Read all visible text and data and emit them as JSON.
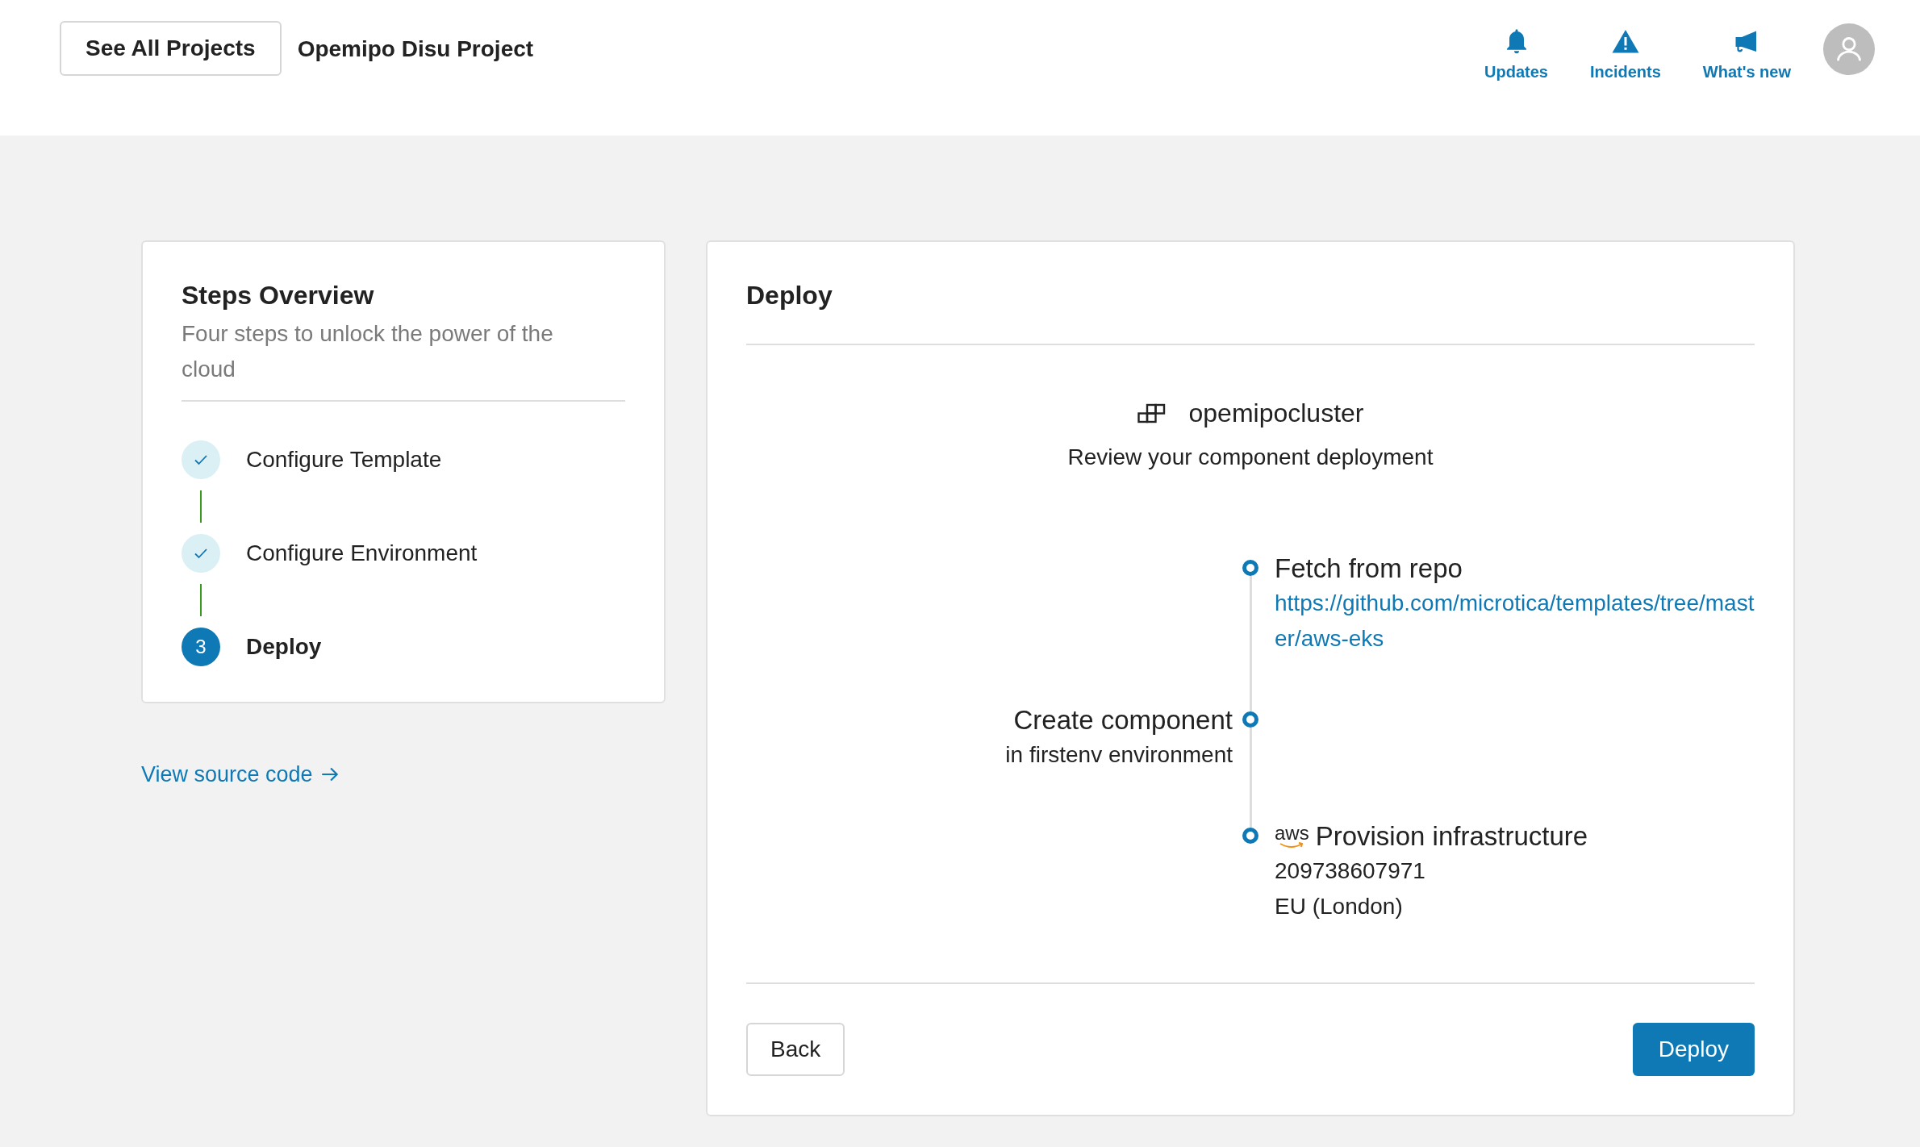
{
  "header": {
    "back_button": "See All Projects",
    "project_title": "Opemipo Disu Project",
    "nav": [
      {
        "label": "Updates"
      },
      {
        "label": "Incidents"
      },
      {
        "label": "What's new"
      }
    ]
  },
  "steps_panel": {
    "title": "Steps Overview",
    "subtitle": "Four steps to unlock the power of the cloud",
    "steps": [
      {
        "label": "Configure Template",
        "done": true
      },
      {
        "label": "Configure Environment",
        "done": true
      },
      {
        "label": "Deploy",
        "done": false,
        "number": "3"
      }
    ]
  },
  "source_link": "View source code",
  "deploy_panel": {
    "title": "Deploy",
    "cluster": "opemipocluster",
    "description": "Review your component deployment",
    "timeline": [
      {
        "kind": "right",
        "title": "Fetch from repo",
        "lines": [
          {
            "kind": "link",
            "text": "https://github.com/microtica/templates/tree/master/aws-eks"
          }
        ]
      },
      {
        "kind": "left",
        "title": "Create component",
        "lines": [
          {
            "kind": "text",
            "text": "in firstenv environment"
          }
        ]
      },
      {
        "kind": "right",
        "badge": "aws",
        "title": "Provision infrastructure",
        "lines": [
          {
            "kind": "text",
            "text": "209738607971"
          },
          {
            "kind": "text",
            "text": "EU (London)"
          }
        ]
      }
    ],
    "buttons": [
      {
        "label": "Back",
        "kind": "secondary"
      },
      {
        "label": "Deploy",
        "kind": "primary"
      }
    ]
  }
}
